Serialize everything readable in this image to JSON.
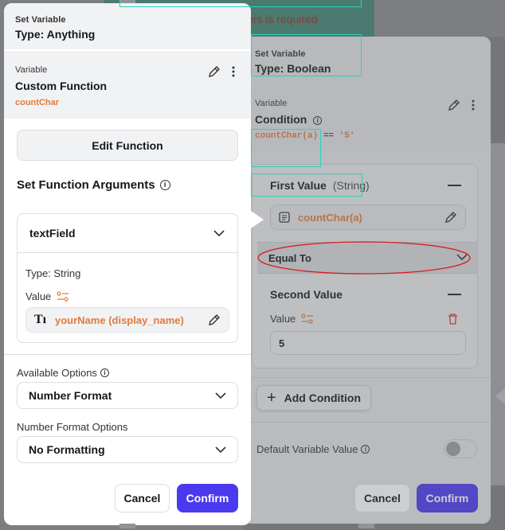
{
  "background": {
    "error_text": "ers is required"
  },
  "right_panel": {
    "header": {
      "kind": "Set Variable",
      "type": "Type: Boolean"
    },
    "variable": {
      "kind": "Variable",
      "name": "Condition",
      "expression": "countChar(a)",
      "operator_text": "==",
      "compare_value": "'5'"
    },
    "condition": {
      "first_value_label": "First Value",
      "first_value_type": "(String)",
      "first_value": "countChar(a)",
      "operator": "Equal To",
      "second_value_label": "Second Value",
      "value_label": "Value",
      "second_value": "5"
    },
    "add_condition": "Add Condition",
    "default_value_label": "Default Variable Value",
    "cancel": "Cancel",
    "confirm": "Confirm"
  },
  "left_panel": {
    "header": {
      "kind": "Set Variable",
      "type": "Type: Anything"
    },
    "variable": {
      "kind": "Variable",
      "name": "Custom Function",
      "function_name": "countChar"
    },
    "edit_function": "Edit Function",
    "section_title": "Set Function Arguments",
    "argument": {
      "name": "textField",
      "type_label": "Type: String",
      "value_label": "Value",
      "value": "yourName (display_name)"
    },
    "available_options_label": "Available Options",
    "available_options_value": "Number Format",
    "number_format_label": "Number Format Options",
    "number_format_value": "No Formatting",
    "cancel": "Cancel",
    "confirm": "Confirm"
  },
  "colors": {
    "accent": "#4b39ef",
    "orange": "#e07b3c",
    "annotation": "#d21f1f"
  }
}
